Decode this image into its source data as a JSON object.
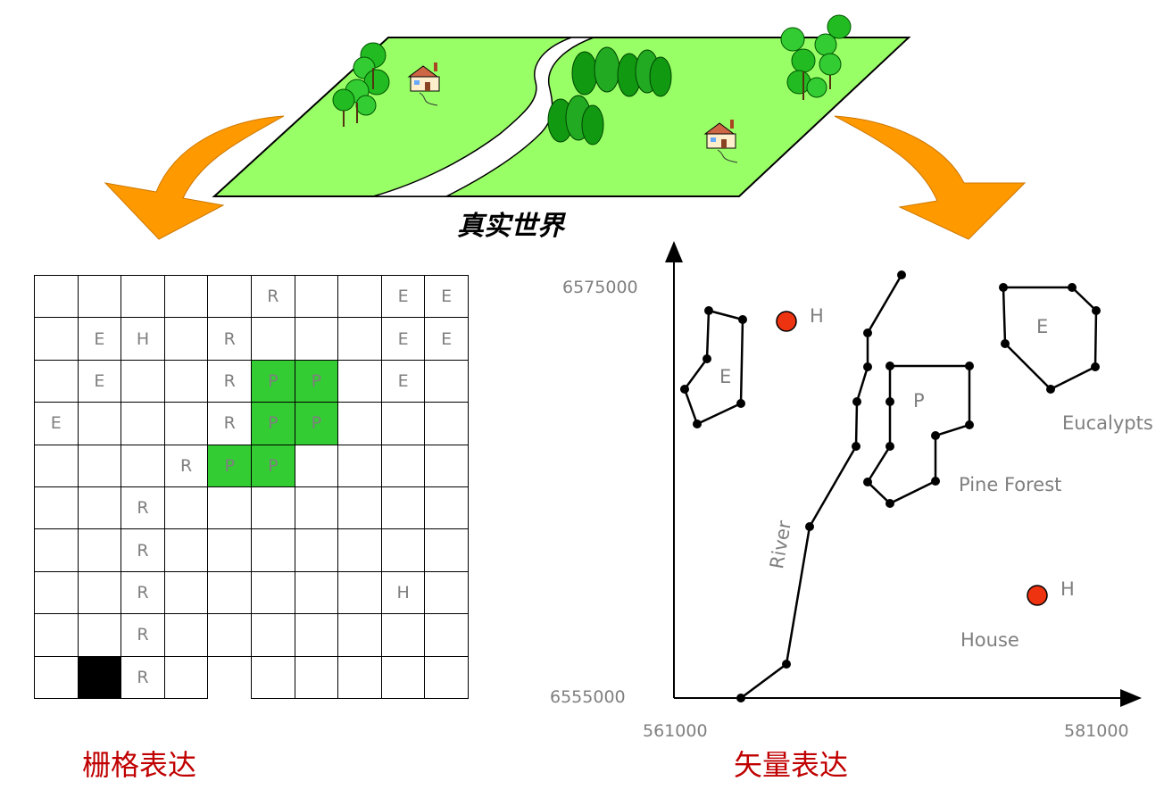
{
  "real_world_label": "真实世界",
  "raster_caption": "栅格表达",
  "vector_caption": "矢量表达",
  "raster_grid": [
    [
      "",
      "",
      "",
      "",
      "",
      "R",
      "",
      "",
      "E",
      "E"
    ],
    [
      "",
      "E",
      "H",
      "",
      "R",
      "",
      "",
      "",
      "E",
      "E"
    ],
    [
      "",
      "E",
      "",
      "",
      "R",
      "P",
      "P",
      "",
      "E",
      ""
    ],
    [
      "E",
      "",
      "",
      "",
      "R",
      "P",
      "P",
      "",
      "",
      ""
    ],
    [
      "",
      "",
      "",
      "R",
      "P",
      "P",
      "",
      "",
      "",
      ""
    ],
    [
      "",
      "",
      "R",
      "",
      "",
      "",
      "",
      "",
      "",
      ""
    ],
    [
      "",
      "",
      "R",
      "",
      "",
      "",
      "",
      "",
      "",
      ""
    ],
    [
      "",
      "",
      "R",
      "",
      "",
      "",
      "",
      "",
      "H",
      ""
    ],
    [
      "",
      "",
      "R",
      "",
      "",
      "",
      "",
      "",
      "",
      ""
    ],
    [
      "",
      "#",
      "R",
      "",
      "_",
      "",
      "",
      "",
      "",
      ""
    ]
  ],
  "vector": {
    "y_top": "6575000",
    "y_bottom": "6555000",
    "x_left": "561000",
    "x_right": "581000",
    "labels": {
      "h1": "H",
      "h2": "H",
      "e_small": "E",
      "e_big": "E",
      "p": "P",
      "eucalypts": "Eucalypts",
      "pine_forest": "Pine Forest",
      "river": "River",
      "house": "House"
    }
  },
  "colors": {
    "land": "#99ff66",
    "pine_cell": "#33cc33",
    "arrow": "#ff9900",
    "house_point": "#ee3311",
    "caption": "#c00000"
  }
}
